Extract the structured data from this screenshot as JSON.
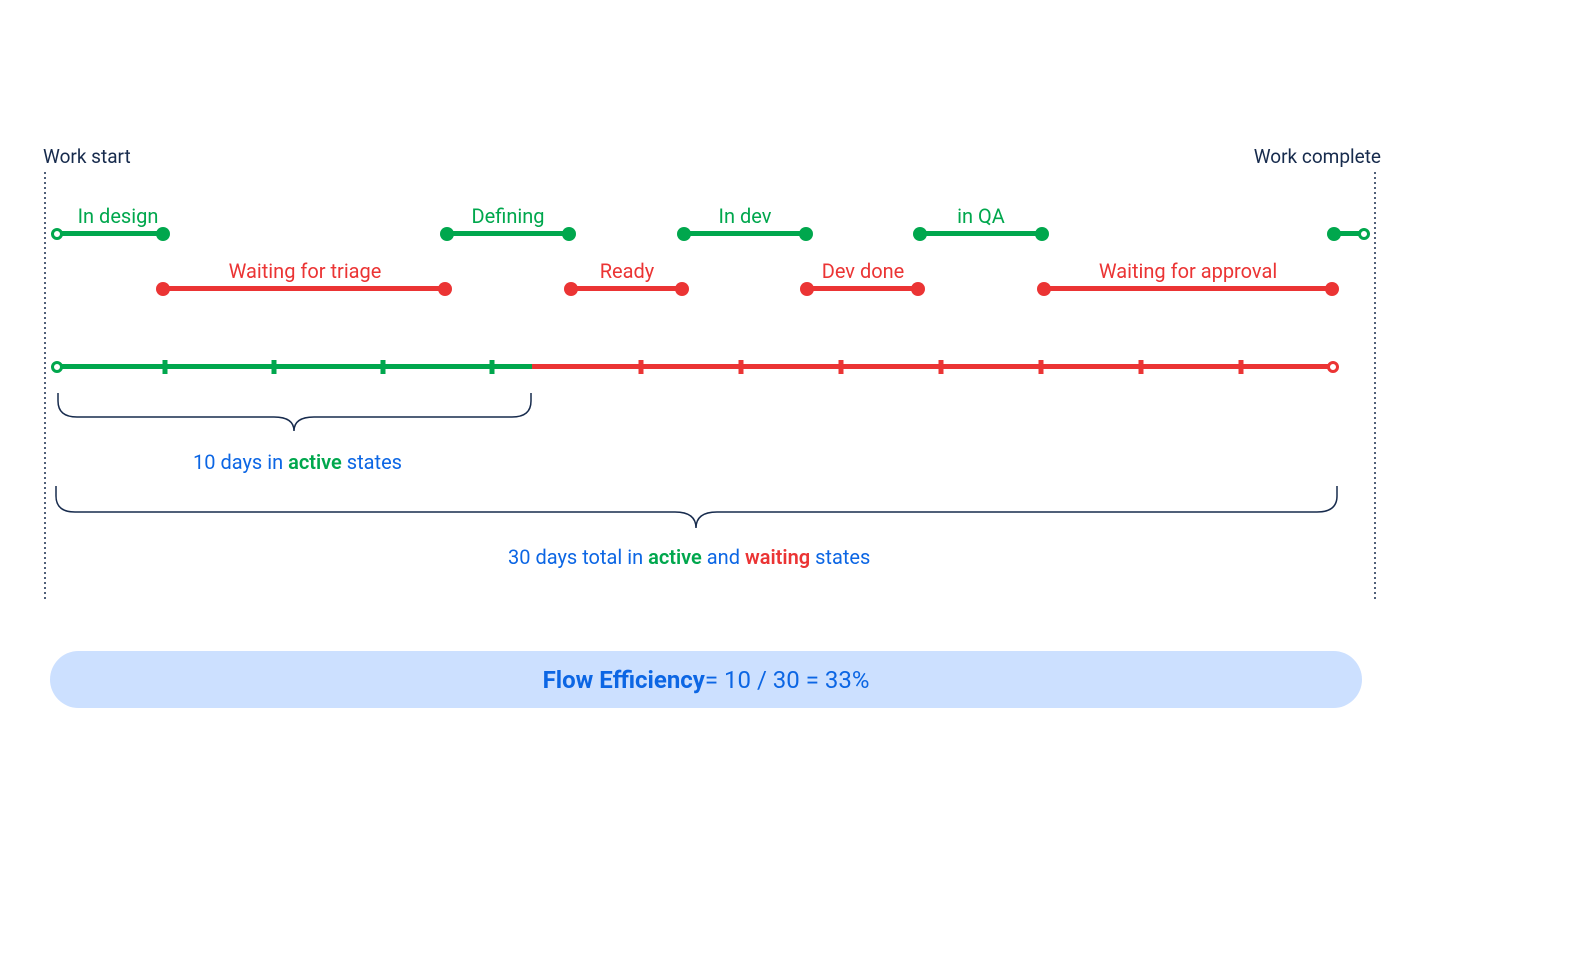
{
  "boundaries": {
    "start": "Work start",
    "end": "Work complete"
  },
  "segments": {
    "active": [
      {
        "key": "in_design",
        "label": "In design"
      },
      {
        "key": "defining",
        "label": "Defining"
      },
      {
        "key": "in_dev",
        "label": "In dev"
      },
      {
        "key": "in_qa",
        "label": "in QA"
      }
    ],
    "waiting": [
      {
        "key": "waiting_triage",
        "label": "Waiting for triage"
      },
      {
        "key": "ready",
        "label": "Ready"
      },
      {
        "key": "dev_done",
        "label": "Dev done"
      },
      {
        "key": "waiting_approval",
        "label": "Waiting for approval"
      }
    ]
  },
  "brace_active": {
    "text_days": "10 days in ",
    "text_active": "active",
    "text_states": " states"
  },
  "brace_total": {
    "text_days": "30 days total in ",
    "text_active": "active",
    "text_and": " and ",
    "text_waiting": "waiting",
    "text_states": " states"
  },
  "result": {
    "label": "Flow Efficiency",
    "eq": " = 10 / 30 = 33%"
  },
  "colors": {
    "green": "#00a74d",
    "red": "#eb3434",
    "blue": "#0c66e4",
    "lightblue": "#cce0ff",
    "text": "#172b4d"
  },
  "metrics": {
    "active_days": 10,
    "total_days": 30,
    "efficiency_pct": 33
  }
}
